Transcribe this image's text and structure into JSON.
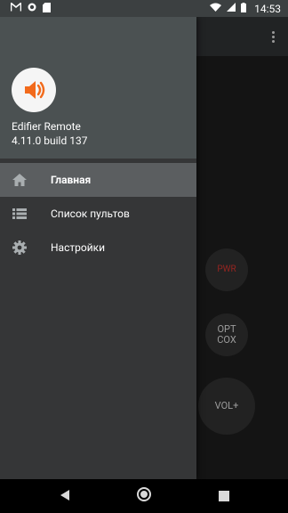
{
  "status_bar": {
    "time": "14:53",
    "icons": [
      "gmail-icon",
      "circle-notification-icon",
      "sd-card-icon",
      "wifi-icon",
      "signal-icon",
      "battery-icon"
    ]
  },
  "drawer": {
    "app_name": "Edifier Remote",
    "app_version": "4.11.0 build 137",
    "logo_icon": "speaker-icon",
    "logo_color": "#f26a1b",
    "items": [
      {
        "label": "Главная",
        "icon": "home-icon",
        "active": true
      },
      {
        "label": "Список пультов",
        "icon": "list-icon",
        "active": false
      },
      {
        "label": "Настройки",
        "icon": "gear-icon",
        "active": false
      }
    ]
  },
  "remote": {
    "power_label": "PWR",
    "input_label_line1": "OPT",
    "input_label_line2": "COX",
    "vol_up_label": "VOL+"
  },
  "colors": {
    "drawer_header": "#4b5152",
    "drawer_background": "#353637",
    "active_item": "#5b5e60",
    "power_red": "#c8312b"
  }
}
